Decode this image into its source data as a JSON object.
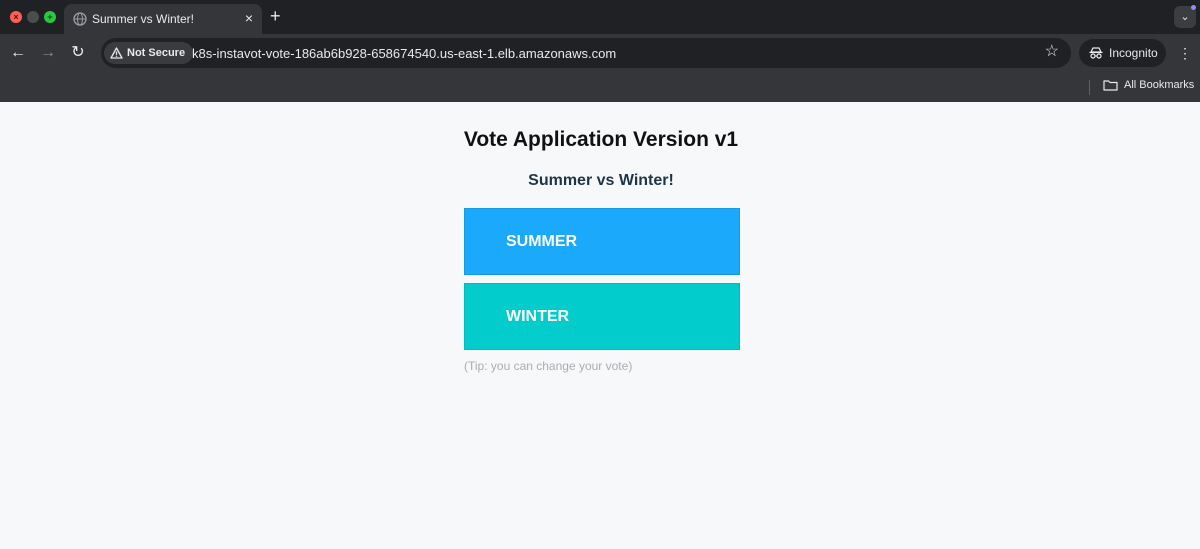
{
  "browser": {
    "tab": {
      "title": "Summer vs Winter!",
      "close": "×"
    },
    "new_tab": "+",
    "tab_menu": "⌄",
    "nav": {
      "back": "←",
      "forward": "→",
      "reload": "↻"
    },
    "address": {
      "security_label": "Not Secure",
      "url": "k8s-instavot-vote-186ab6b928-658674540.us-east-1.elb.amazonaws.com",
      "bookmark_star": "☆"
    },
    "profile": {
      "label": "Incognito"
    },
    "menu": "⋮",
    "bookmarks_bar": {
      "all_bookmarks": "All Bookmarks"
    }
  },
  "app": {
    "title": "Vote Application Version v1",
    "subtitle": "Summer vs Winter!",
    "options": [
      {
        "label": "SUMMER",
        "color": "#1aa9fb"
      },
      {
        "label": "WINTER",
        "color": "#03cccc"
      }
    ],
    "tip": "(Tip: you can change your vote)"
  }
}
